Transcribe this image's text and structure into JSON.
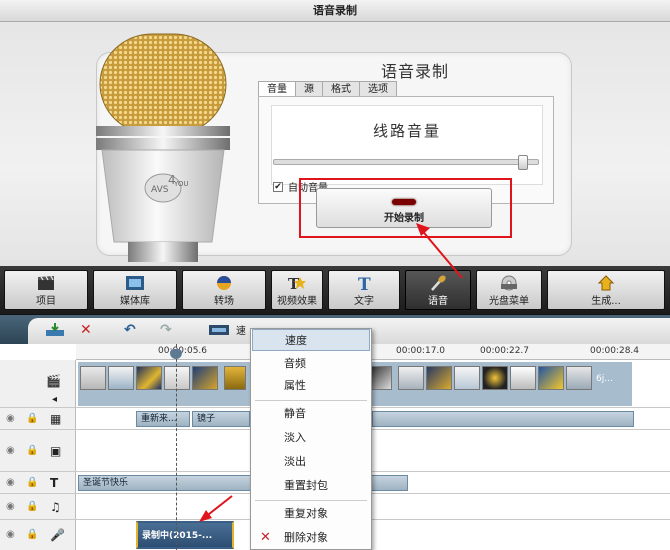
{
  "window": {
    "title": "语音录制"
  },
  "recorder": {
    "heading": "语音录制",
    "tabs": [
      {
        "label": "音量",
        "active": true
      },
      {
        "label": "源",
        "active": false
      },
      {
        "label": "格式",
        "active": false
      },
      {
        "label": "选项",
        "active": false
      }
    ],
    "line_volume_label": "线路音量",
    "volume_level_percent": 97,
    "auto_volume": {
      "label": "自动音量",
      "checked": true
    },
    "start_button_label": "开始录制"
  },
  "modebar": {
    "buttons": [
      {
        "label": "项目",
        "icon": "clapper-icon",
        "active": false
      },
      {
        "label": "媒体库",
        "icon": "film-icon",
        "active": false
      },
      {
        "label": "转场",
        "icon": "transition-icon",
        "active": false
      },
      {
        "label": "视频效果",
        "icon": "effects-icon",
        "active": false
      },
      {
        "label": "文字",
        "icon": "text-icon",
        "active": false
      },
      {
        "label": "语音",
        "icon": "microphone-icon",
        "active": true
      },
      {
        "label": "光盘菜单",
        "icon": "disc-icon",
        "active": false
      },
      {
        "label": "生成...",
        "icon": "produce-icon",
        "active": false
      }
    ]
  },
  "timeline_toolbar": {
    "speed_fragment": "速"
  },
  "timeline": {
    "ruler_ticks": [
      "00:00:05.6",
      "00:00:17.0",
      "00:00:22.7",
      "00:00:28.4"
    ],
    "tracks": {
      "effect_clips": [
        "重新来...",
        "镜子"
      ],
      "text_clip": "圣诞节快乐",
      "voice_clip": "录制中(2015-..."
    },
    "video_thumb_tail_label": "6j..."
  },
  "context_menu": {
    "items": [
      "速度",
      "音频",
      "属性",
      "静音",
      "淡入",
      "淡出",
      "重置封包",
      "重复对象",
      "删除对象"
    ],
    "highlighted": "速度"
  },
  "colors": {
    "annotation_red": "#e0151b",
    "active_mode_bg": "#2f2f2f"
  }
}
